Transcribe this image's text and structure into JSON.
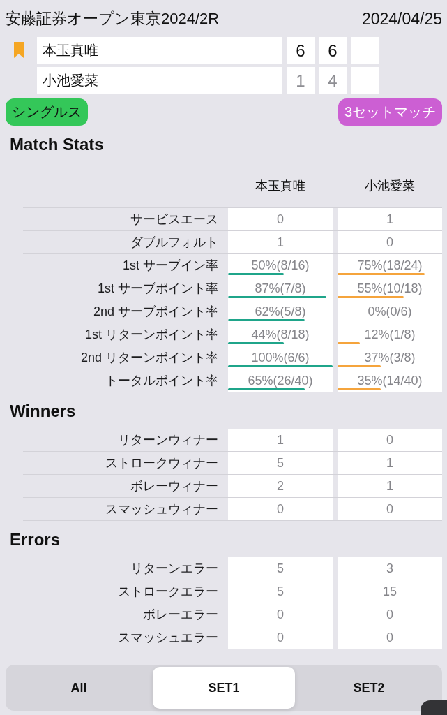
{
  "header": {
    "title": "安藤証券オープン東京2024/2R",
    "date": "2024/04/25"
  },
  "players": [
    {
      "name": "本玉真唯",
      "bookmarked": true,
      "sets": [
        {
          "kind": "score",
          "value": "6",
          "won": true
        },
        {
          "kind": "score",
          "value": "6",
          "won": true
        },
        {
          "kind": "blank"
        }
      ]
    },
    {
      "name": "小池愛菜",
      "bookmarked": false,
      "sets": [
        {
          "kind": "score",
          "value": "1",
          "won": false
        },
        {
          "kind": "score",
          "value": "4",
          "won": false
        },
        {
          "kind": "blank"
        }
      ]
    }
  ],
  "tags": [
    {
      "label": "シングルス",
      "color": "#34c759"
    },
    {
      "label": "3セットマッチ",
      "color": "#cc5fd3"
    }
  ],
  "sections": [
    {
      "title": "Match Stats",
      "columns": [
        "本玉真唯",
        "小池愛菜"
      ],
      "rows": [
        {
          "label": "サービスエース",
          "values": [
            {
              "text": "0"
            },
            {
              "text": "1"
            }
          ]
        },
        {
          "label": "ダブルフォルト",
          "values": [
            {
              "text": "1"
            },
            {
              "text": "0"
            }
          ]
        },
        {
          "label": "1st サーブイン率",
          "values": [
            {
              "text": "50%(8/16)",
              "level": 0.53
            },
            {
              "text": "75%(18/24)",
              "level": 0.83
            }
          ]
        },
        {
          "label": "1st サーブポイント率",
          "values": [
            {
              "text": "87%(7/8)",
              "level": 0.94
            },
            {
              "text": "55%(10/18)",
              "level": 0.63
            }
          ]
        },
        {
          "label": "2nd サーブポイント率",
          "values": [
            {
              "text": "62%(5/8)",
              "level": 0.73
            },
            {
              "text": "0%(0/6)"
            }
          ]
        },
        {
          "label": "1st リターンポイント率",
          "values": [
            {
              "text": "44%(8/18)",
              "level": 0.53
            },
            {
              "text": "12%(1/8)",
              "level": 0.21
            }
          ]
        },
        {
          "label": "2nd リターンポイント率",
          "values": [
            {
              "text": "100%(6/6)",
              "level": 1
            },
            {
              "text": "37%(3/8)",
              "level": 0.41
            }
          ]
        },
        {
          "label": "トータルポイント率",
          "values": [
            {
              "text": "65%(26/40)",
              "level": 0.73
            },
            {
              "text": "35%(14/40)",
              "level": 0.41
            }
          ]
        }
      ]
    },
    {
      "title": "Winners",
      "rows": [
        {
          "label": "リターンウィナー",
          "values": [
            {
              "text": "1"
            },
            {
              "text": "0"
            }
          ]
        },
        {
          "label": "ストロークウィナー",
          "values": [
            {
              "text": "5"
            },
            {
              "text": "1"
            }
          ]
        },
        {
          "label": "ボレーウィナー",
          "values": [
            {
              "text": "2"
            },
            {
              "text": "1"
            }
          ]
        },
        {
          "label": "スマッシュウィナー",
          "values": [
            {
              "text": "0"
            },
            {
              "text": "0"
            }
          ]
        }
      ]
    },
    {
      "title": "Errors",
      "rows": [
        {
          "label": "リターンエラー",
          "values": [
            {
              "text": "5"
            },
            {
              "text": "3"
            }
          ]
        },
        {
          "label": "ストロークエラー",
          "values": [
            {
              "text": "5"
            },
            {
              "text": "15"
            }
          ]
        },
        {
          "label": "ボレーエラー",
          "values": [
            {
              "text": "0"
            },
            {
              "text": "0"
            }
          ]
        },
        {
          "label": "スマッシュエラー",
          "values": [
            {
              "text": "0"
            },
            {
              "text": "0"
            }
          ]
        }
      ]
    }
  ],
  "set_tabs": [
    {
      "label": "All",
      "selected": false
    },
    {
      "label": "SET1",
      "selected": true
    },
    {
      "label": "SET2",
      "selected": false
    }
  ]
}
